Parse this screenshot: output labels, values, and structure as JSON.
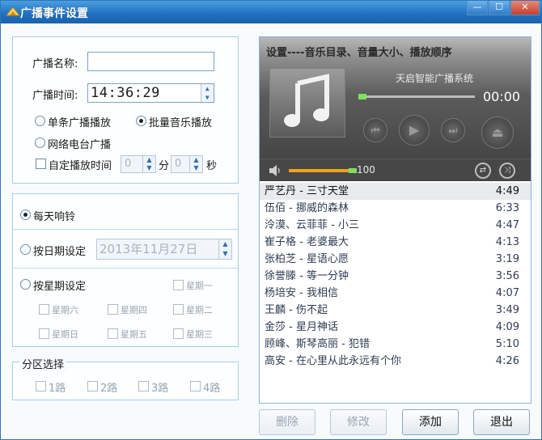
{
  "window": {
    "title": "广播事件设置",
    "min_icon": "minimize-icon",
    "max_icon": "maximize-icon",
    "close_icon": "close-icon"
  },
  "basic": {
    "name_label": "广播名称:",
    "name_value": "",
    "time_label": "广播时间:",
    "time_value": "14:36:29",
    "radio_single": "单条广播播放",
    "radio_batch": "批量音乐播放",
    "radio_network": "网络电台广播",
    "custom_time_label": "自定播放时间",
    "minutes_value": "0",
    "minutes_unit": "分",
    "seconds_value": "0",
    "seconds_unit": "秒"
  },
  "schedule": {
    "daily": "每天响铃",
    "by_date": "按日期设定",
    "date_value": "2013年11月27日",
    "by_week": "按星期设定",
    "days": [
      "星期一",
      "星期六",
      "星期四",
      "星期二",
      "星期日",
      "星期五",
      "星期三"
    ]
  },
  "zones": {
    "legend": "分区选择",
    "items": [
      "1路",
      "2路",
      "3路",
      "4路"
    ]
  },
  "player": {
    "header": "设置----音乐目录、音量大小、播放顺序",
    "system_name": "天启智能广播系统",
    "time": "00:00",
    "volume": "100",
    "progress": 0.0
  },
  "songs": [
    {
      "title": "严艺丹 - 三寸天堂",
      "duration": "4:49"
    },
    {
      "title": "伍佰 - 挪威的森林",
      "duration": "6:33"
    },
    {
      "title": "泠漠、云菲菲 - 小三",
      "duration": "4:47"
    },
    {
      "title": "崔子格 - 老婆最大",
      "duration": "4:13"
    },
    {
      "title": "张柏芝 - 星语心愿",
      "duration": "3:19"
    },
    {
      "title": "徐誉滕 - 等一分钟",
      "duration": "3:56"
    },
    {
      "title": "杨培安 - 我相信",
      "duration": "4:07"
    },
    {
      "title": "王麟 - 伤不起",
      "duration": "3:49"
    },
    {
      "title": "金莎 - 星月神话",
      "duration": "4:09"
    },
    {
      "title": "顾峰、斯琴高丽 - 犯错",
      "duration": "5:10"
    },
    {
      "title": "高安 - 在心里从此永远有个你",
      "duration": "4:26"
    }
  ],
  "buttons": {
    "delete": "删除",
    "modify": "修改",
    "add": "添加",
    "exit": "退出"
  }
}
